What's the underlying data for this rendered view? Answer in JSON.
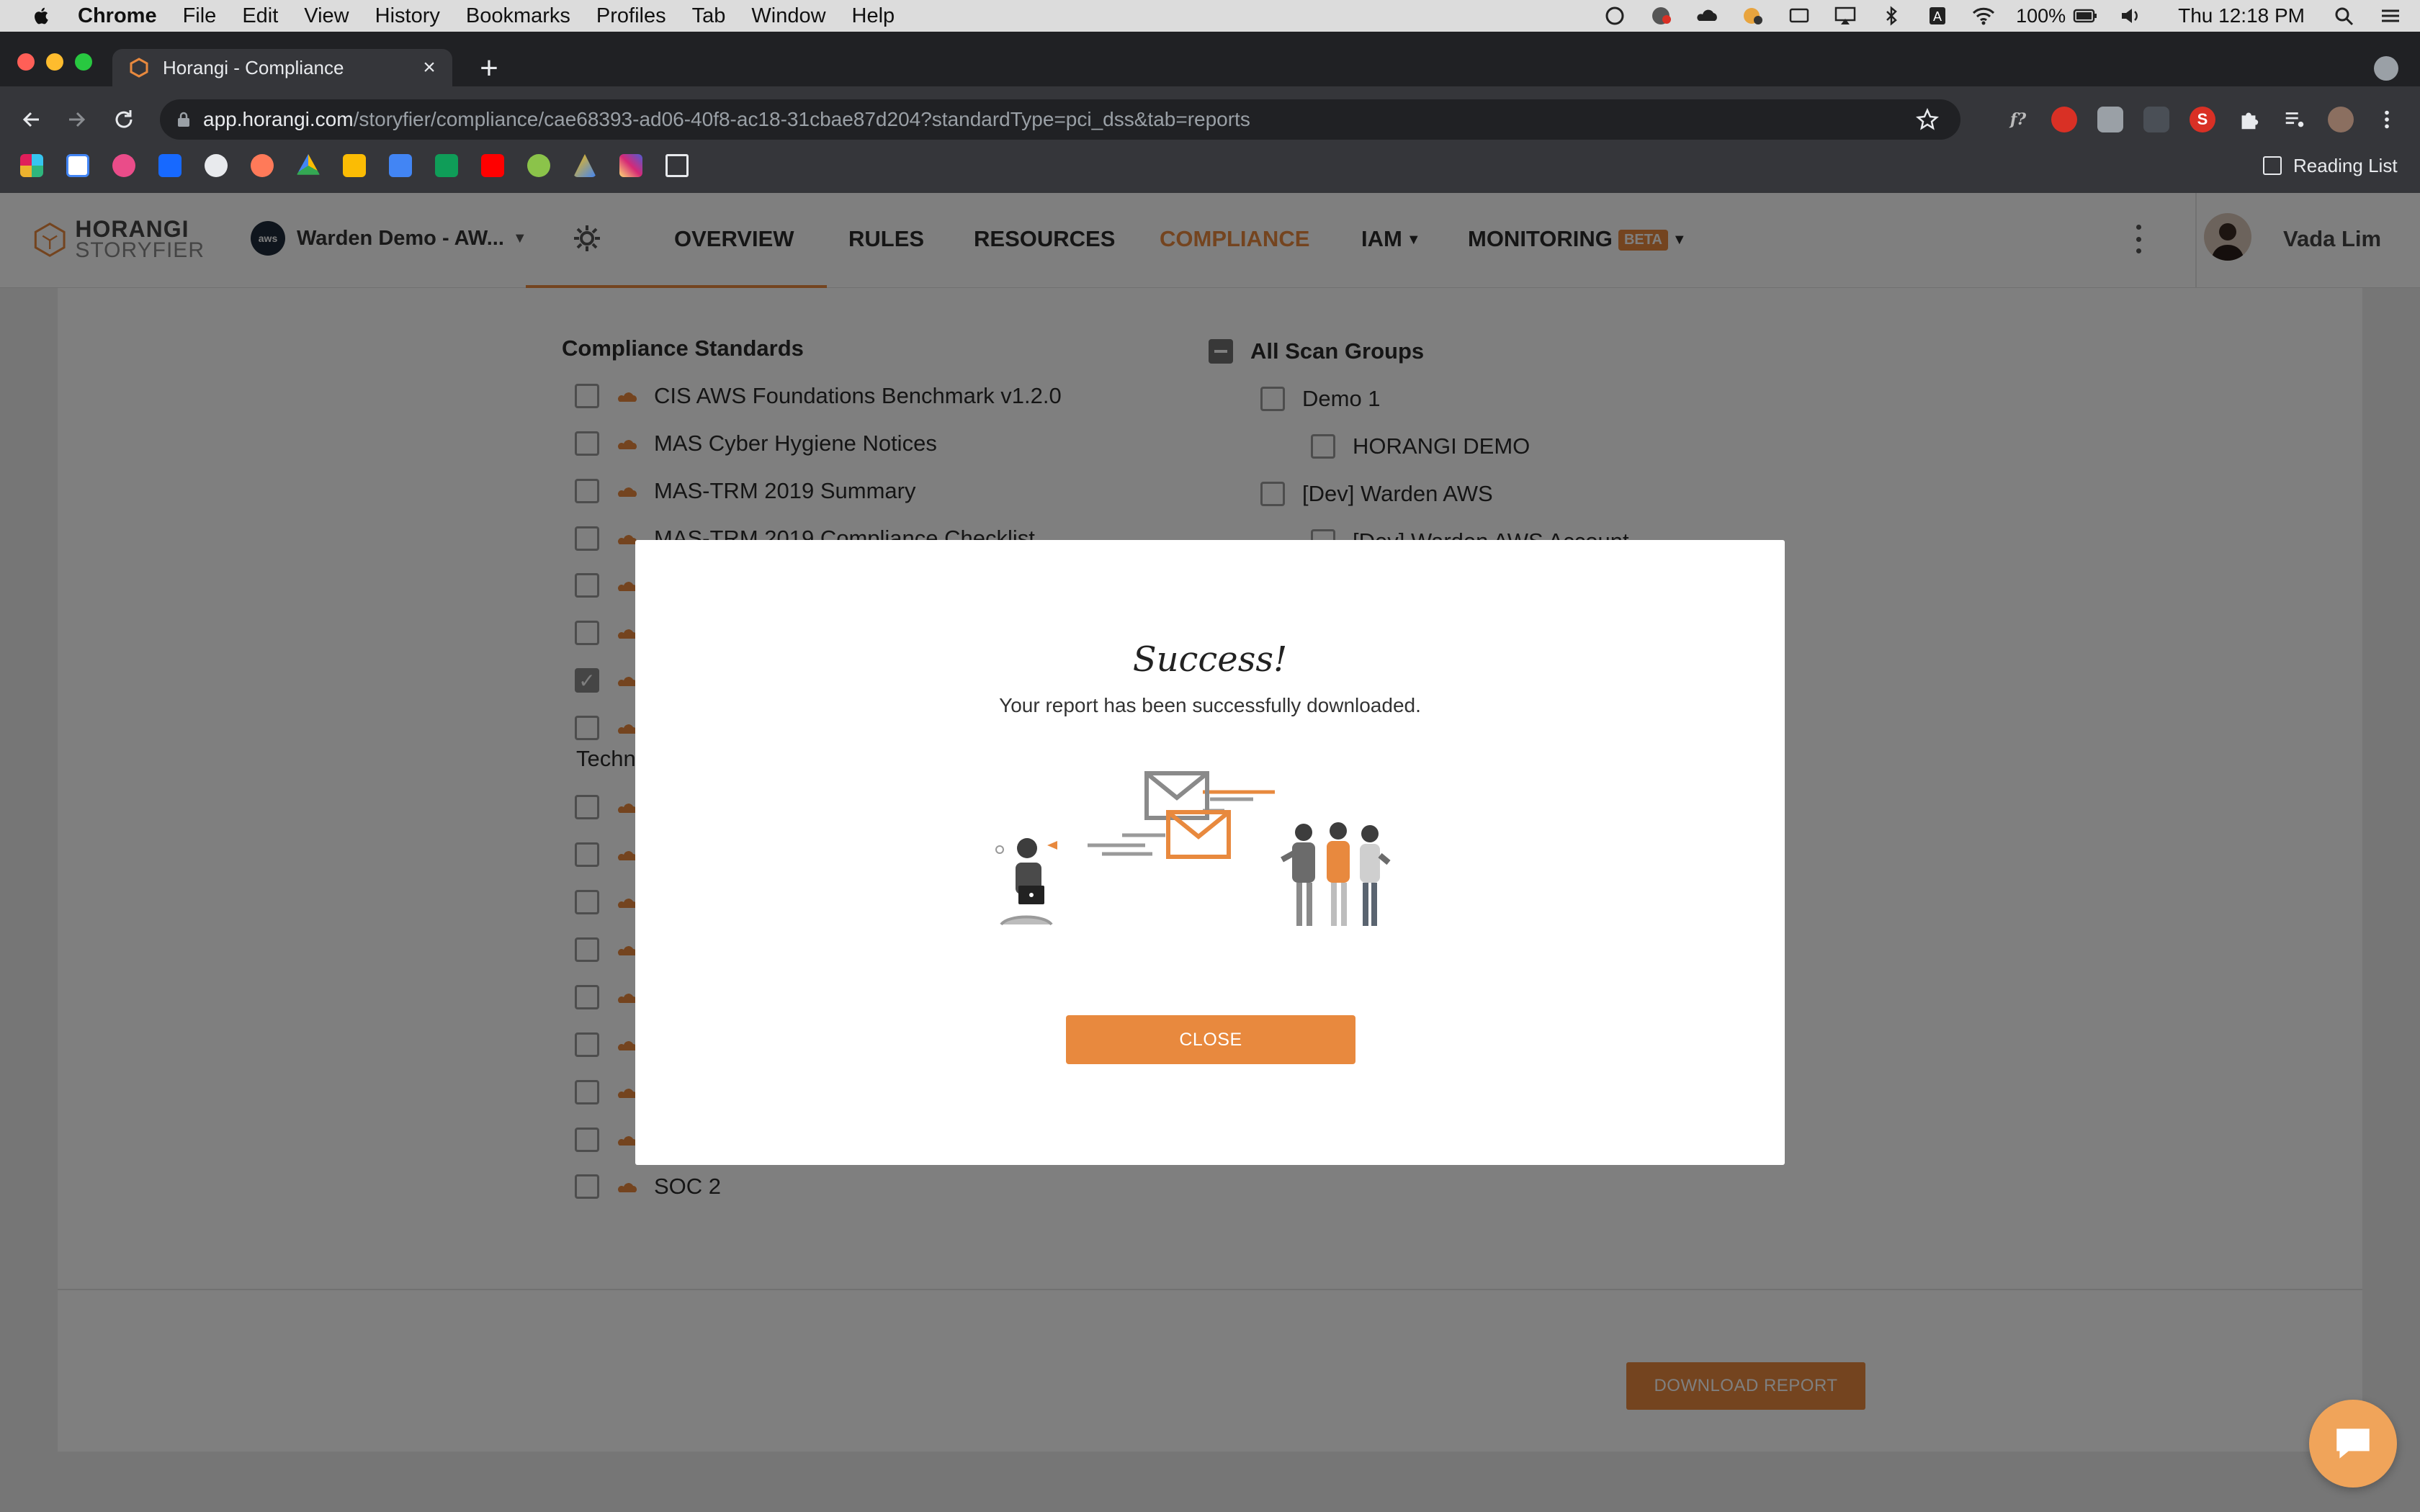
{
  "menubar": {
    "app": "Chrome",
    "items": [
      "File",
      "Edit",
      "View",
      "History",
      "Bookmarks",
      "Profiles",
      "Tab",
      "Window",
      "Help"
    ],
    "battery": "100%",
    "clock": "Thu 12:18 PM"
  },
  "browser": {
    "tab_title": "Horangi - Compliance",
    "url_host": "app.horangi.com",
    "url_path": "/storyfier/compliance/cae68393-ad06-40f8-ac18-31cbae87d204?standardType=pci_dss&tab=reports",
    "reading_list": "Reading List",
    "extension_s": "S"
  },
  "app": {
    "logo_top": "HORANGI",
    "logo_bottom": "STORYFIER",
    "account": "Warden Demo - AW...",
    "aws_badge": "aws",
    "nav": {
      "overview": "OVERVIEW",
      "rules": "RULES",
      "resources": "RESOURCES",
      "compliance": "COMPLIANCE",
      "iam": "IAM",
      "monitoring": "MONITORING",
      "beta": "BETA"
    },
    "user": "Vada Lim"
  },
  "standards": {
    "title": "Compliance Standards",
    "items": [
      {
        "label": "CIS AWS Foundations Benchmark v1.2.0",
        "checked": false
      },
      {
        "label": "MAS Cyber Hygiene Notices",
        "checked": false
      },
      {
        "label": "MAS-TRM 2019 Summary",
        "checked": false
      },
      {
        "label": "MAS-TRM 2019 Compliance Checklist",
        "checked": false
      }
    ],
    "tech_label": "Techn",
    "last_item": "SOC 2"
  },
  "scan_groups": {
    "title": "All Scan Groups",
    "items": [
      {
        "label": "Demo 1",
        "level": 1
      },
      {
        "label": "HORANGI DEMO",
        "level": 2
      },
      {
        "label": "[Dev] Warden AWS",
        "level": 1
      },
      {
        "label": "[Dev] Warden AWS Account",
        "level": 2
      }
    ]
  },
  "download_button": "DOWNLOAD REPORT",
  "modal": {
    "title": "Success!",
    "message": "Your report has been successfully downloaded.",
    "close": "CLOSE"
  },
  "colors": {
    "accent": "#e8893e",
    "overlay": "rgba(0,0,0,0.5)"
  }
}
